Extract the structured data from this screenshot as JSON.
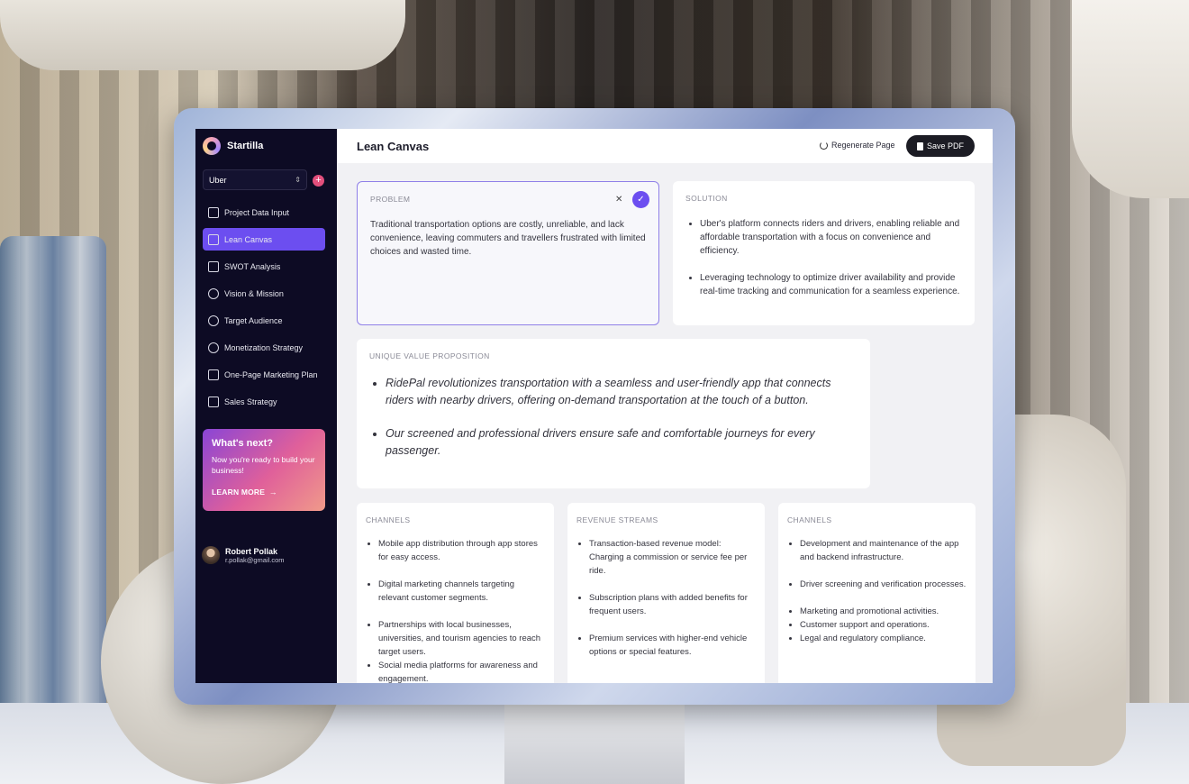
{
  "app": {
    "name": "Startilla"
  },
  "project_select": {
    "value": "Uber"
  },
  "nav": {
    "items": [
      {
        "label": "Project Data Input"
      },
      {
        "label": "Lean Canvas"
      },
      {
        "label": "SWOT Analysis"
      },
      {
        "label": "Vision & Mission"
      },
      {
        "label": "Target Audience"
      },
      {
        "label": "Monetization Strategy"
      },
      {
        "label": "One-Page Marketing Plan"
      },
      {
        "label": "Sales Strategy"
      }
    ]
  },
  "promo": {
    "title": "What's next?",
    "text": "Now you're ready to build your business!",
    "link": "LEARN MORE"
  },
  "user": {
    "name": "Robert Pollak",
    "email": "r.pollak@gmail.com"
  },
  "header": {
    "title": "Lean Canvas",
    "regenerate_label": "Regenerate Page",
    "save_label": "Save PDF"
  },
  "problem": {
    "label": "PROBLEM",
    "text": "Traditional transportation options are costly, unreliable, and lack convenience, leaving commuters and travellers frustrated with limited choices and wasted time."
  },
  "solution": {
    "label": "SOLUTION",
    "items": [
      "Uber's platform connects riders and drivers, enabling reliable and affordable transportation with a focus on convenience and efficiency.",
      "Leveraging technology to optimize driver availability and provide real-time tracking and communication for a seamless experience."
    ]
  },
  "uvp": {
    "label": "UNIQUE VALUE PROPOSITION",
    "items": [
      "RidePal revolutionizes transportation with a seamless and user-friendly app that connects riders with nearby drivers, offering on-demand transportation at the touch of a button.",
      "Our screened and professional drivers ensure safe and comfortable journeys for every passenger."
    ]
  },
  "channels": {
    "label": "CHANNELS",
    "items": [
      "Mobile app distribution through app stores for easy access.",
      "Digital marketing channels targeting relevant customer segments.",
      "Partnerships with local businesses, universities, and tourism agencies to reach target users.",
      "Social media platforms for awareness and engagement."
    ]
  },
  "revenue": {
    "label": "REVENUE STREAMS",
    "items": [
      "Transaction-based revenue model: Charging a commission or service fee per ride.",
      "Subscription plans with added benefits for frequent users.",
      "Premium services with higher-end vehicle options or special features."
    ]
  },
  "channels2": {
    "label": "CHANNELS",
    "items": [
      "Development and maintenance of the app and backend infrastructure.",
      "Driver screening and verification processes.",
      "Marketing and promotional activities.",
      "Customer support and operations.",
      "Legal and regulatory compliance."
    ]
  }
}
